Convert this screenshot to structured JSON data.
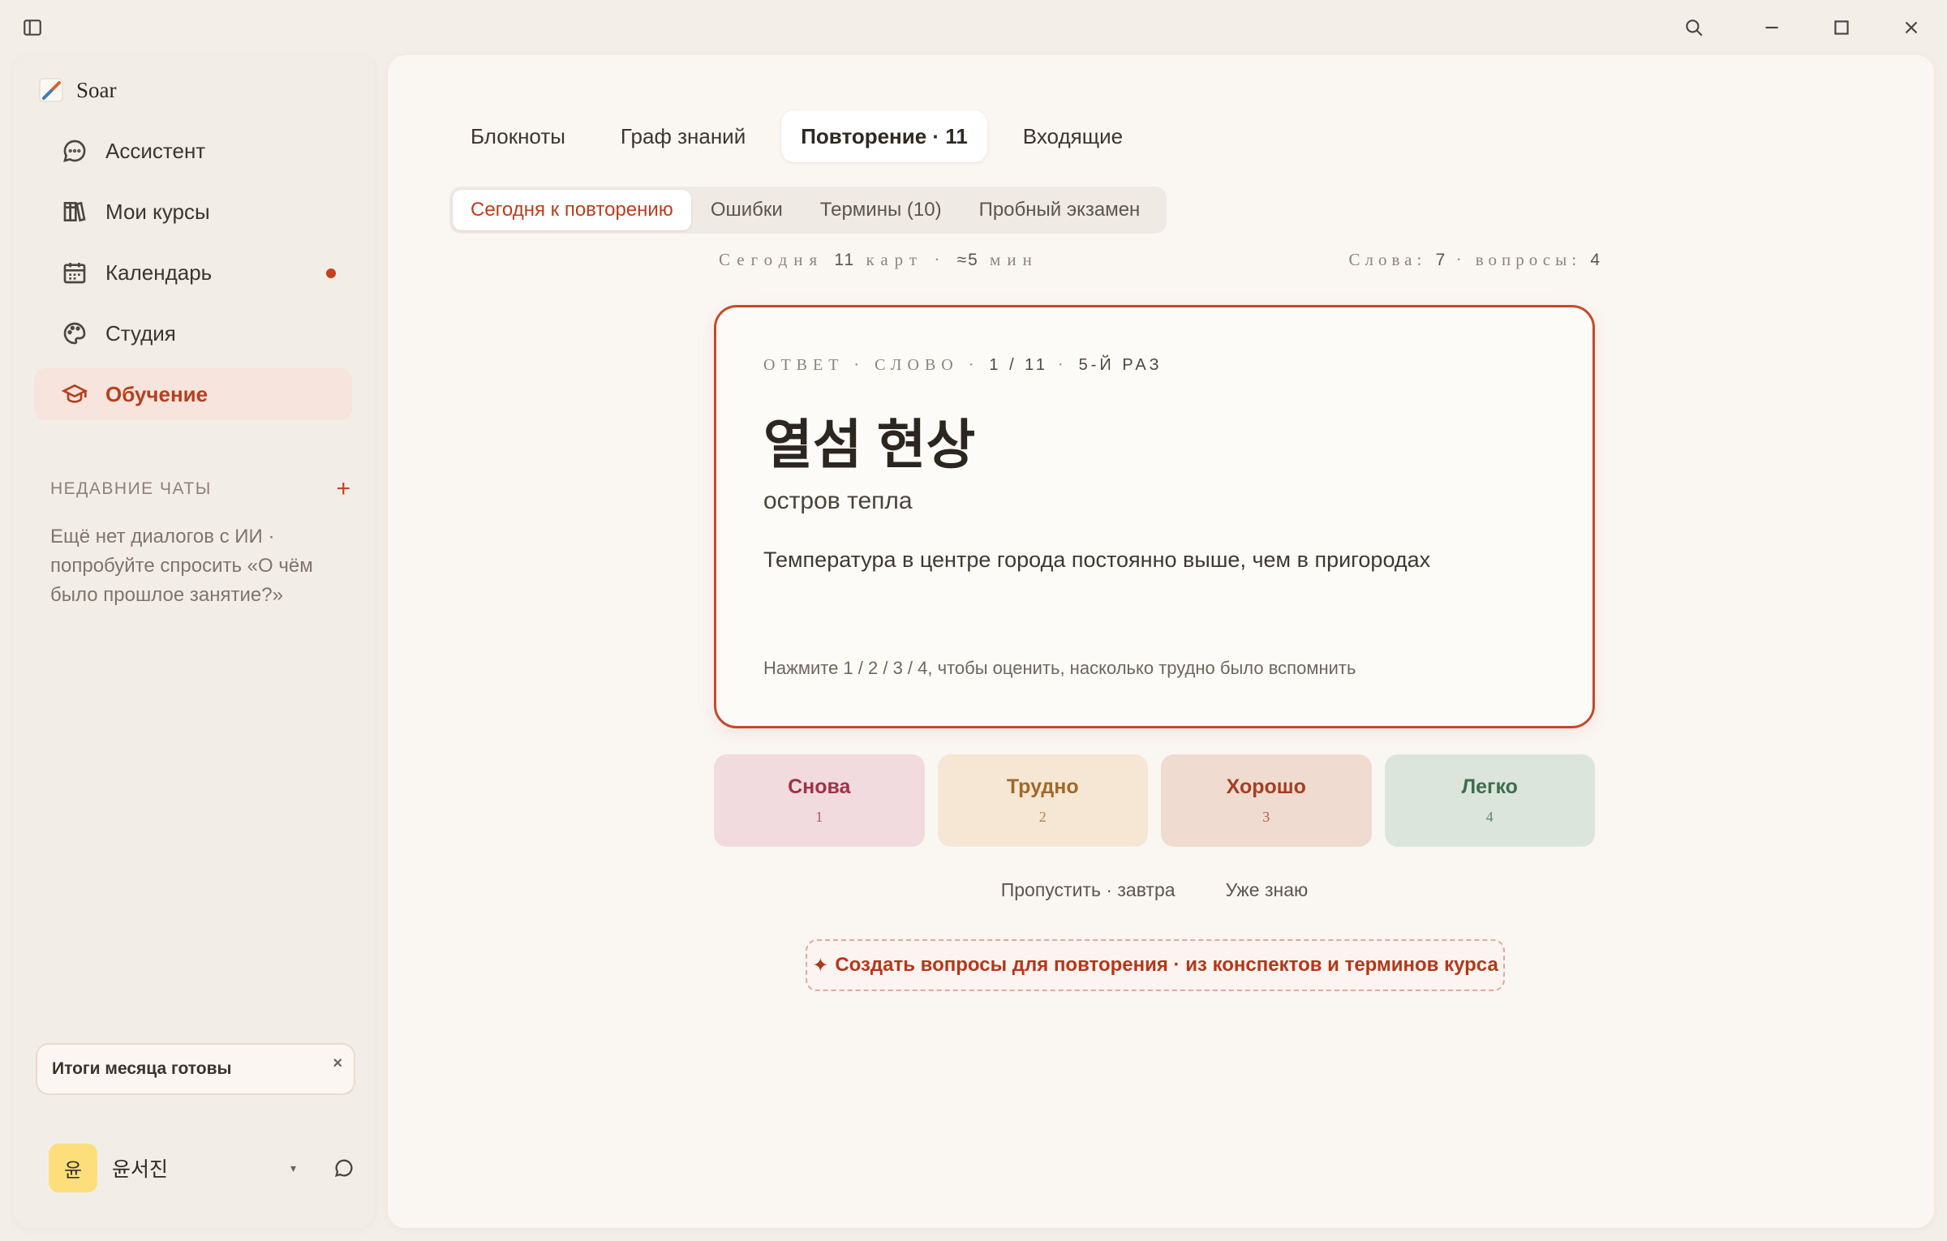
{
  "app": {
    "name": "Soar"
  },
  "nav": {
    "items": [
      {
        "label": "Ассистент",
        "icon": "chat-bubble-icon"
      },
      {
        "label": "Мои курсы",
        "icon": "books-icon"
      },
      {
        "label": "Календарь",
        "icon": "calendar-icon",
        "badge": "dot"
      },
      {
        "label": "Студия",
        "icon": "palette-icon"
      },
      {
        "label": "Обучение",
        "icon": "graduation-cap-icon",
        "active": true
      }
    ]
  },
  "recent": {
    "title": "НЕДАВНИЕ ЧАТЫ",
    "add": "+",
    "empty": "Ещё нет диалогов с ИИ · попробуйте спросить «О чём было прошлое занятие?»"
  },
  "notice": {
    "text": "Итоги месяца готовы",
    "close": "×"
  },
  "user": {
    "avatar": "윤",
    "name": "윤서진",
    "caret": "▾"
  },
  "tabs": [
    {
      "label": "Блокноты"
    },
    {
      "label": "Граф знаний"
    },
    {
      "label": "Повторение · 11",
      "active": true
    },
    {
      "label": "Входящие"
    }
  ],
  "subtabs": [
    {
      "label": "Сегодня к повторению",
      "active": true
    },
    {
      "label": "Ошибки"
    },
    {
      "label": "Термины (10)"
    },
    {
      "label": "Пробный экзамен"
    }
  ],
  "stats": {
    "left_a": "Сегодня ",
    "left_count": "11",
    "left_b": " карт · ",
    "left_time": "≈5",
    "left_c": " мин",
    "right_a": "Слова: ",
    "right_words": "7",
    "right_b": " · вопросы: ",
    "right_questions": "4"
  },
  "card": {
    "meta_a": "ОТВЕТ · СЛОВО · ",
    "meta_pos": "1 / 11",
    "meta_b": " · ",
    "meta_rep": "5-Й РАЗ",
    "term": "열섬 현상",
    "translation": "остров тепла",
    "example": "Температура в центре города постоянно выше, чем в пригородах",
    "hint": "Нажмите 1 / 2 / 3 / 4, чтобы оценить, насколько трудно было вспомнить"
  },
  "grades": [
    {
      "label": "Снова",
      "key": "1"
    },
    {
      "label": "Трудно",
      "key": "2"
    },
    {
      "label": "Хорошо",
      "key": "3"
    },
    {
      "label": "Легко",
      "key": "4"
    }
  ],
  "secondary": {
    "skip": "Пропустить · завтра",
    "known": "Уже знаю"
  },
  "generate": {
    "icon": "✦",
    "label": "Создать вопросы для повторения · из конспектов и терминов курса"
  },
  "colors": {
    "accent": "#c2441d",
    "background": "#f3efe8",
    "panel": "#faf7f3"
  }
}
